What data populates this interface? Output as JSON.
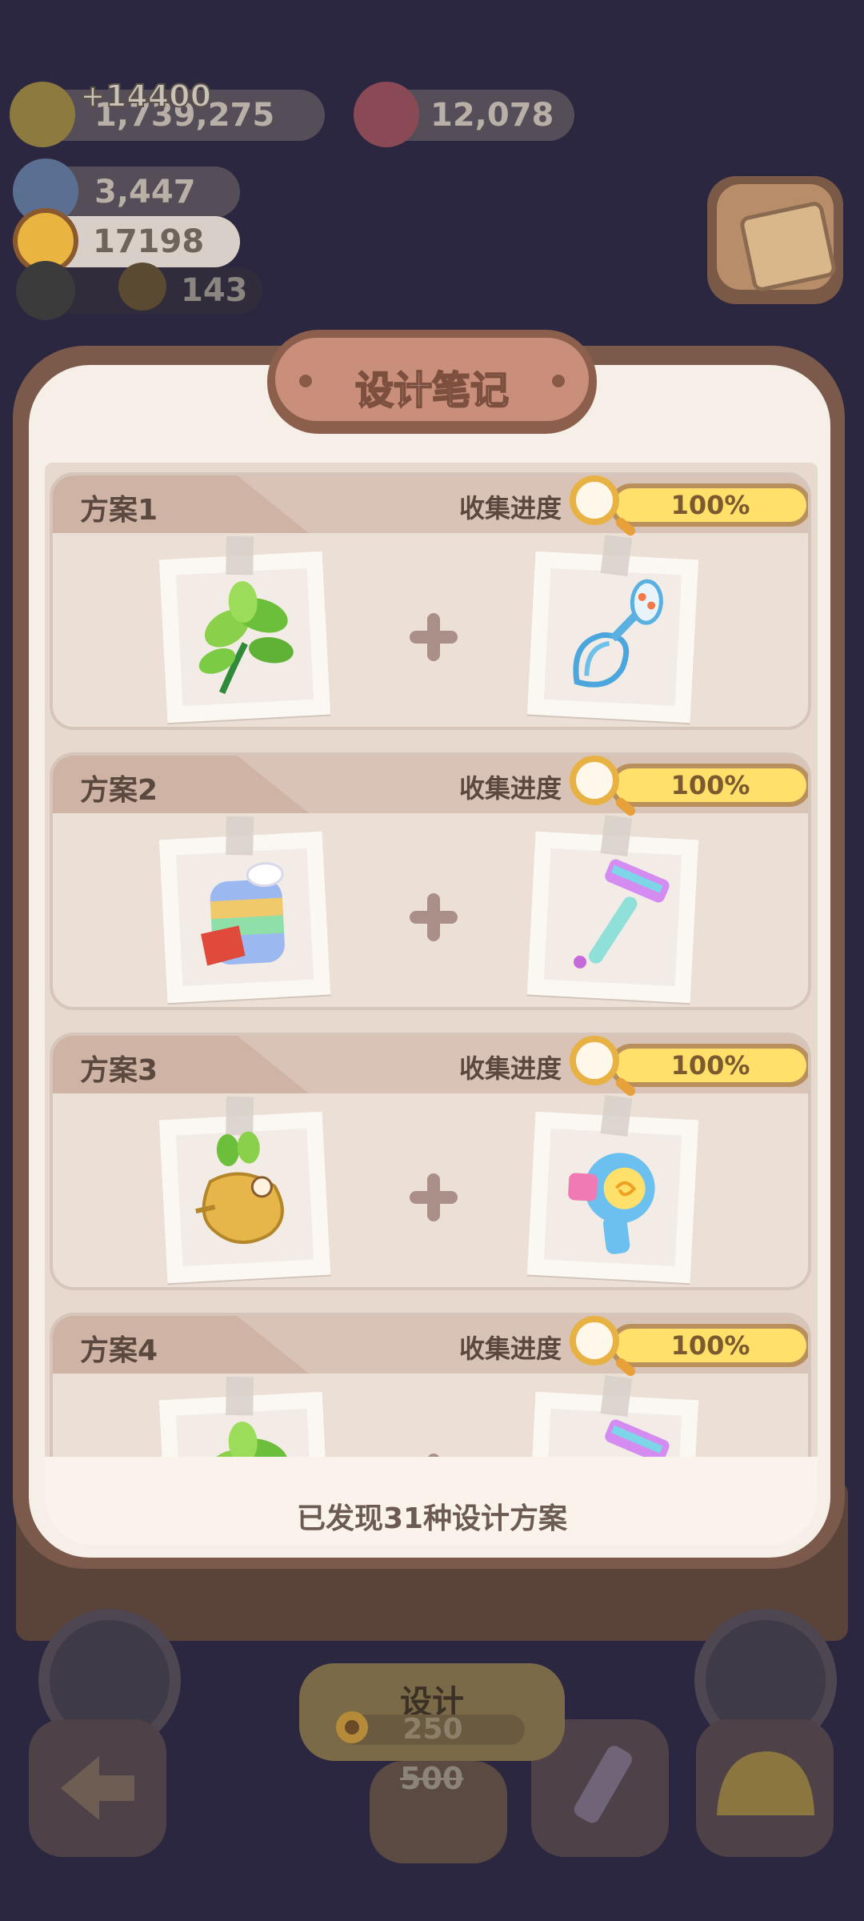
{
  "hud": {
    "gain": "+14400",
    "coins": "1,739,275",
    "gems": "12,078",
    "crystals": "3,447",
    "sunflowers": "17198",
    "pets": "143"
  },
  "dialog": {
    "title": "设计笔记",
    "progress_label": "收集进度",
    "found_text": "已发现31种设计方案",
    "schemes": [
      {
        "name": "方案1",
        "progress_text": "100%",
        "progress": 1.0,
        "items": [
          "herb-icon",
          "whisk-icon"
        ]
      },
      {
        "name": "方案2",
        "progress_text": "100%",
        "progress": 1.0,
        "items": [
          "rainbow-bag-icon",
          "razor-icon"
        ]
      },
      {
        "name": "方案3",
        "progress_text": "100%",
        "progress": 1.0,
        "items": [
          "mandrake-icon",
          "hair-dryer-icon"
        ]
      },
      {
        "name": "方案4",
        "progress_text": "100%",
        "progress": 1.0,
        "items": [
          "herb-icon",
          "razor-icon"
        ]
      }
    ]
  },
  "action": {
    "design_label": "设计",
    "cost": "250",
    "old_cost": "500"
  },
  "colors": {
    "progress_fill": "#ffe06b",
    "dialog_frame": "#7b5a4b",
    "title_plaque": "#c98f7a"
  }
}
